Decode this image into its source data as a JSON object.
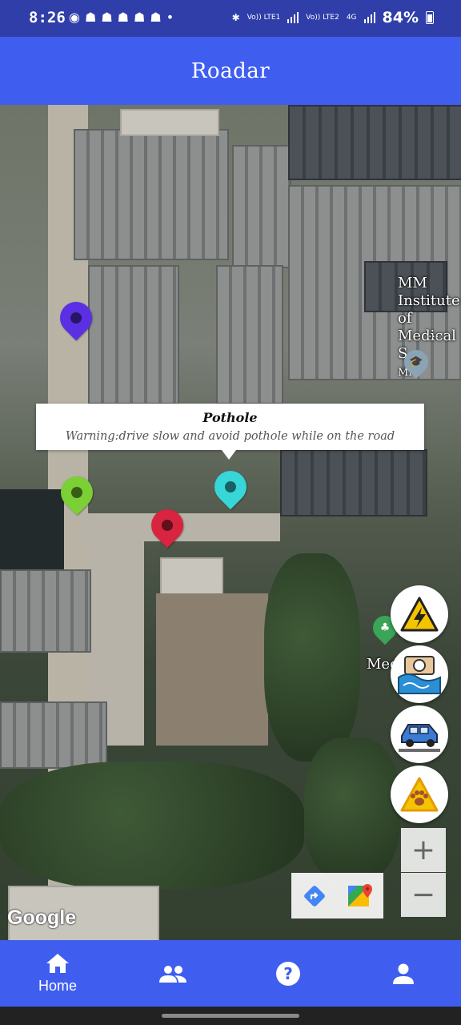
{
  "status_bar": {
    "time": "8:26",
    "net1": "Vo)) LTE1",
    "net2": "Vo)) LTE2",
    "net_type": "4G",
    "battery": "84%"
  },
  "app_bar": {
    "title": "Roadar"
  },
  "map": {
    "labels": {
      "institute": "MM Institute of Medical S",
      "institute_sub": "MM",
      "institute_more": "...",
      "park": "Med"
    },
    "info_window": {
      "title": "Pothole",
      "snippet": "Warning:drive slow and avoid pothole while on the road"
    },
    "markers": [
      {
        "name": "marker-purple",
        "color": "#5b2fe3"
      },
      {
        "name": "marker-green",
        "color": "#7ad034"
      },
      {
        "name": "marker-cyan",
        "color": "#37d6d8"
      },
      {
        "name": "marker-red",
        "color": "#d8243f"
      }
    ],
    "zoom_in": "+",
    "zoom_out": "−",
    "google_logo": "Google"
  },
  "fabs": [
    {
      "name": "electric-hazard-button",
      "icon": "electric-hazard-icon"
    },
    {
      "name": "flooded-road-button",
      "icon": "flooded-road-icon"
    },
    {
      "name": "accident-button",
      "icon": "car-accident-icon"
    },
    {
      "name": "animal-crossing-button",
      "icon": "animal-warning-icon"
    }
  ],
  "bottom_nav": {
    "items": [
      {
        "label": "Home",
        "icon": "home-icon"
      },
      {
        "label": "",
        "icon": "group-icon"
      },
      {
        "label": "",
        "icon": "help-icon"
      },
      {
        "label": "",
        "icon": "profile-icon"
      }
    ]
  },
  "colors": {
    "primary": "#3f5ef0",
    "status_bar": "#2f3ea8"
  }
}
